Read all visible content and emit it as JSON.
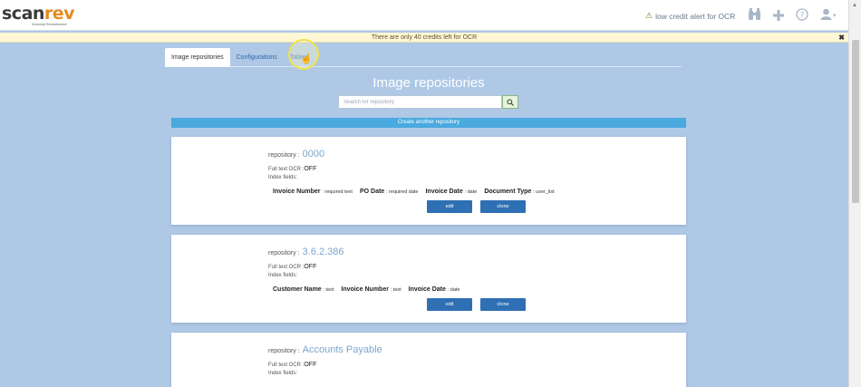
{
  "brand": {
    "logo_part1": "scan",
    "logo_part2": "rev",
    "tagline": "Scanning Revolutionized"
  },
  "header": {
    "alert_text": "low credit alert for OCR"
  },
  "credit_notice": "There are only 40 credits left for OCR",
  "tabs": [
    "Image repositories",
    "Configurations",
    "Tables"
  ],
  "page_title": "Image repositories",
  "search": {
    "placeholder": "Search for repository"
  },
  "create_button": "Create another repository",
  "labels": {
    "repository": "repository :",
    "full_text_ocr": "Full text OCR :",
    "index_fields": "Index fields:",
    "edit": "edit",
    "clone": "clone"
  },
  "repositories": [
    {
      "name": "0000",
      "ocr": "OFF",
      "fields": [
        {
          "name": "Invoice Number",
          "type": ": required text"
        },
        {
          "name": "PO Date",
          "type": ": required date"
        },
        {
          "name": "Invoice Date",
          "type": ": date"
        },
        {
          "name": "Document Type",
          "type": ": user_list"
        }
      ]
    },
    {
      "name": "3.6.2.386",
      "ocr": "OFF",
      "fields": [
        {
          "name": "Customer Name",
          "type": ": text"
        },
        {
          "name": "Invoice Number",
          "type": ": text"
        },
        {
          "name": "Invoice Date",
          "type": ": date"
        }
      ]
    },
    {
      "name": "Accounts Payable",
      "ocr": "OFF",
      "fields": []
    }
  ],
  "icons": {
    "warning": "warning-icon",
    "binoculars": "binoculars-icon",
    "plus": "plus-icon",
    "help": "help-icon",
    "user": "user-icon",
    "search": "search-icon",
    "close": "close-icon"
  },
  "colors": {
    "background": "#aec8e6",
    "logo_orange": "#e58a1f",
    "create_button": "#4aa9df",
    "action_button": "#2f6fb3",
    "notice_bg": "#fff7d6"
  }
}
